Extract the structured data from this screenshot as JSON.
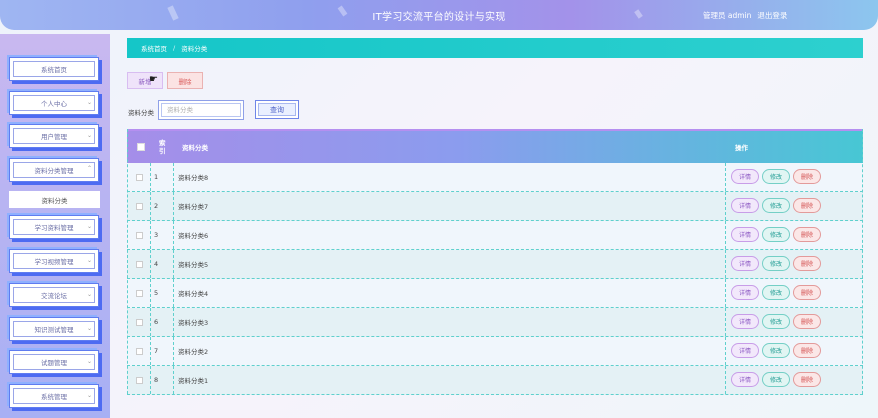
{
  "header": {
    "title": "IT学习交流平台的设计与实现",
    "role_label": "管理员 admin",
    "logout_label": "退出登录"
  },
  "sidebar": {
    "items": [
      {
        "label": "系统首页"
      },
      {
        "label": "个人中心"
      },
      {
        "label": "用户管理"
      },
      {
        "label": "资料分类管理"
      },
      {
        "label": "学习资料管理"
      },
      {
        "label": "学习视频管理"
      },
      {
        "label": "交流论坛"
      },
      {
        "label": "知识测试管理"
      },
      {
        "label": "试题管理"
      },
      {
        "label": "系统管理"
      }
    ],
    "sub_item": {
      "label": "资料分类"
    }
  },
  "breadcrumb": {
    "home": "系统首页",
    "separator": "/",
    "current": "资料分类"
  },
  "actions": {
    "add_label": "新增",
    "delete_label": "删除"
  },
  "search": {
    "label": "资料分类",
    "placeholder": "资料分类",
    "query_label": "查询"
  },
  "table": {
    "columns": [
      "索引",
      "资料分类",
      "操作"
    ],
    "rows": [
      {
        "index": "1",
        "category": "资料分类8"
      },
      {
        "index": "2",
        "category": "资料分类7"
      },
      {
        "index": "3",
        "category": "资料分类6"
      },
      {
        "index": "4",
        "category": "资料分类5"
      },
      {
        "index": "5",
        "category": "资料分类4"
      },
      {
        "index": "6",
        "category": "资料分类3"
      },
      {
        "index": "7",
        "category": "资料分类2"
      },
      {
        "index": "8",
        "category": "资料分类1"
      }
    ],
    "op_labels": {
      "detail": "详情",
      "edit": "修改",
      "delete": "删除"
    }
  },
  "colors": {
    "accent_teal": "#15c6c8",
    "accent_purple": "#a58ee9",
    "sidebar_blue": "#5f7cf0"
  }
}
